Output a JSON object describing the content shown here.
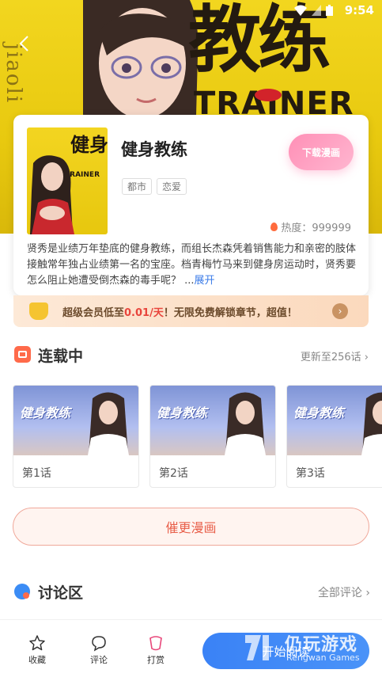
{
  "status_bar": {
    "time": "9:54"
  },
  "hero": {
    "banner_title": "教练",
    "banner_subtitle": "TRAINER",
    "banner_vertical_text": "jiaoli"
  },
  "comic": {
    "title": "健身教练",
    "cover_title": "健身教练",
    "cover_subtitle": "TRAINER",
    "tags": [
      "都市",
      "恋爱"
    ],
    "download_label": "下载漫画",
    "heat_label": "热度：999999",
    "description": "贤秀是业绩万年垫底的健身教练，而组长杰森凭着销售能力和亲密的肢体接触常年独占业绩第一名的宝座。档青梅竹马来到健身房运动时，贤秀要怎么阻止她遭受倒杰森的毒手呢？ ...",
    "expand_label": "展开"
  },
  "vip": {
    "text_before": "超级会员低至",
    "price": "0.01/天",
    "text_after": "！无限免费解锁章节，超值！",
    "arrow": "›"
  },
  "serial": {
    "title": "连载中",
    "update_label": "更新至256话 ›",
    "thumb_title": "健身教练",
    "episodes": [
      {
        "label": "第1话"
      },
      {
        "label": "第2话"
      },
      {
        "label": "第3话"
      }
    ],
    "read_more_label": "催更漫画"
  },
  "discussion": {
    "title": "讨论区",
    "all_comments_label": "全部评论 ›"
  },
  "bottom_bar": {
    "favorite_label": "收藏",
    "comment_label": "评论",
    "reward_label": "打赏",
    "start_reading_label": "开始阅读"
  },
  "watermark": {
    "name": "仍玩游戏",
    "domain": "Rengwan Games"
  },
  "colors": {
    "banner_yellow": "#f2d61f",
    "download_pink": "#ff8fb6",
    "accent_blue": "#3a82f6",
    "vip_price_red": "#e8453c",
    "read_more_red": "#e85f4a"
  },
  "icons": [
    "back-arrow-icon",
    "wifi-icon",
    "signal-icon",
    "battery-icon",
    "flame-icon",
    "vip-crown-icon",
    "serial-book-icon",
    "chat-bubble-icon",
    "star-icon",
    "comment-icon",
    "gift-icon"
  ]
}
